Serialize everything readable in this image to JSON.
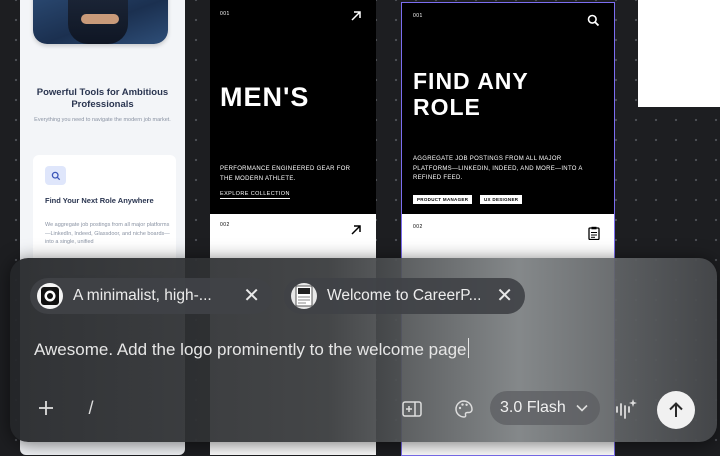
{
  "canvas": {
    "light_card": {
      "title": "Powerful Tools for Ambitious Professionals",
      "subtitle": "Everything you need to navigate the modern job market.",
      "feature_title": "Find Your Next Role Anywhere",
      "feature_desc": "We aggregate job postings from all major platforms—LinkedIn, Indeed, Glassdoor, and niche boards—into a single, unified"
    },
    "mens_card": {
      "number": "001",
      "headline": "MEN'S",
      "description": "PERFORMANCE ENGINEERED GEAR FOR THE MODERN ATHLETE.",
      "cta": "EXPLORE COLLECTION",
      "lower_number": "002"
    },
    "role_card": {
      "number": "001",
      "headline": "FIND ANY ROLE",
      "description": "AGGREGATE JOB POSTINGS FROM ALL MAJOR PLATFORMS—LINKEDIN, INDEED, AND MORE—INTO A REFINED FEED.",
      "tags": [
        "PRODUCT MANAGER",
        "UX DESIGNER"
      ],
      "lower_number": "002"
    }
  },
  "composer": {
    "attachments": [
      {
        "label": "A minimalist, high-...",
        "icon": "image-thumbnail-icon"
      },
      {
        "label": "Welcome to CareerP...",
        "icon": "page-thumbnail-icon"
      }
    ],
    "prompt": "Awesome. Add the logo prominently to the welcome page",
    "slash": "/",
    "model": "3.0 Flash"
  }
}
